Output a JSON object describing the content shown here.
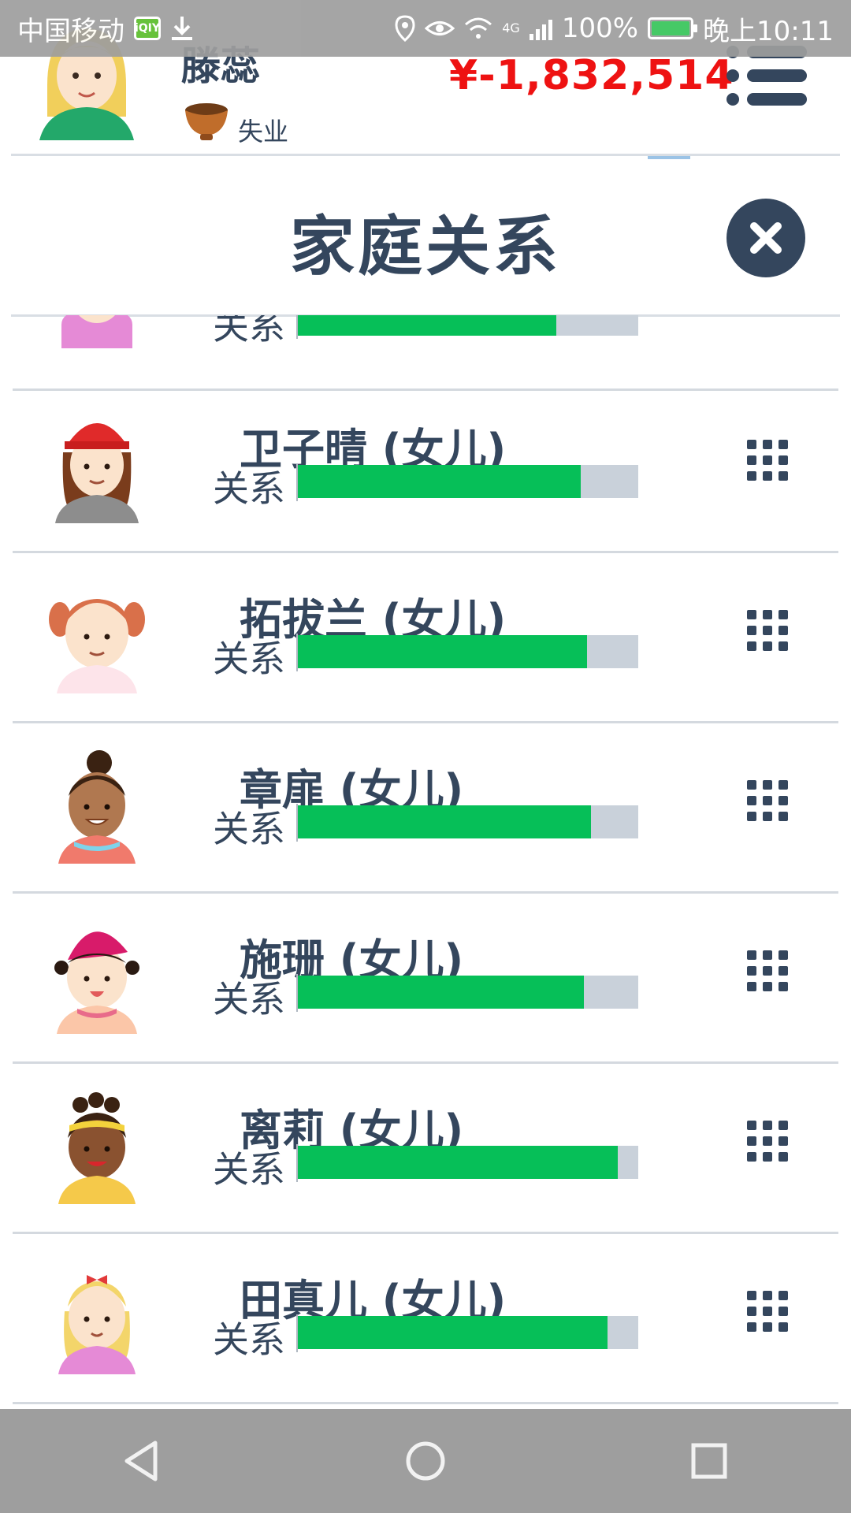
{
  "status_bar": {
    "carrier": "中国移动",
    "network": "4G",
    "battery": "100%",
    "time": "晚上10:11"
  },
  "header": {
    "player_name": "滕蕊",
    "job": "失业",
    "money": "¥-1,832,514"
  },
  "modal": {
    "title": "家庭关系",
    "relation_label": "关系"
  },
  "partial_row": {
    "relation_label": "关系",
    "relationship_level": 0.76
  },
  "members": [
    {
      "name": "卫子晴 (女儿)",
      "relation_label": "关系",
      "relationship_level": 0.83
    },
    {
      "name": "拓拔兰 (女儿)",
      "relation_label": "关系",
      "relationship_level": 0.85
    },
    {
      "name": "章扉 (女儿)",
      "relation_label": "关系",
      "relationship_level": 0.86
    },
    {
      "name": "施珊 (女儿)",
      "relation_label": "关系",
      "relationship_level": 0.84
    },
    {
      "name": "离莉 (女儿)",
      "relation_label": "关系",
      "relationship_level": 0.94
    },
    {
      "name": "田真儿 (女儿)",
      "relation_label": "关系",
      "relationship_level": 0.91
    }
  ],
  "colors": {
    "text": "#34465d",
    "money": "#ee1212",
    "bar_fill": "#06bf58",
    "bar_track": "#c9d1da"
  },
  "icons": [
    "menu-icon",
    "close-icon",
    "grid-icon",
    "bowl-icon",
    "back-icon",
    "home-icon",
    "recents-icon"
  ]
}
